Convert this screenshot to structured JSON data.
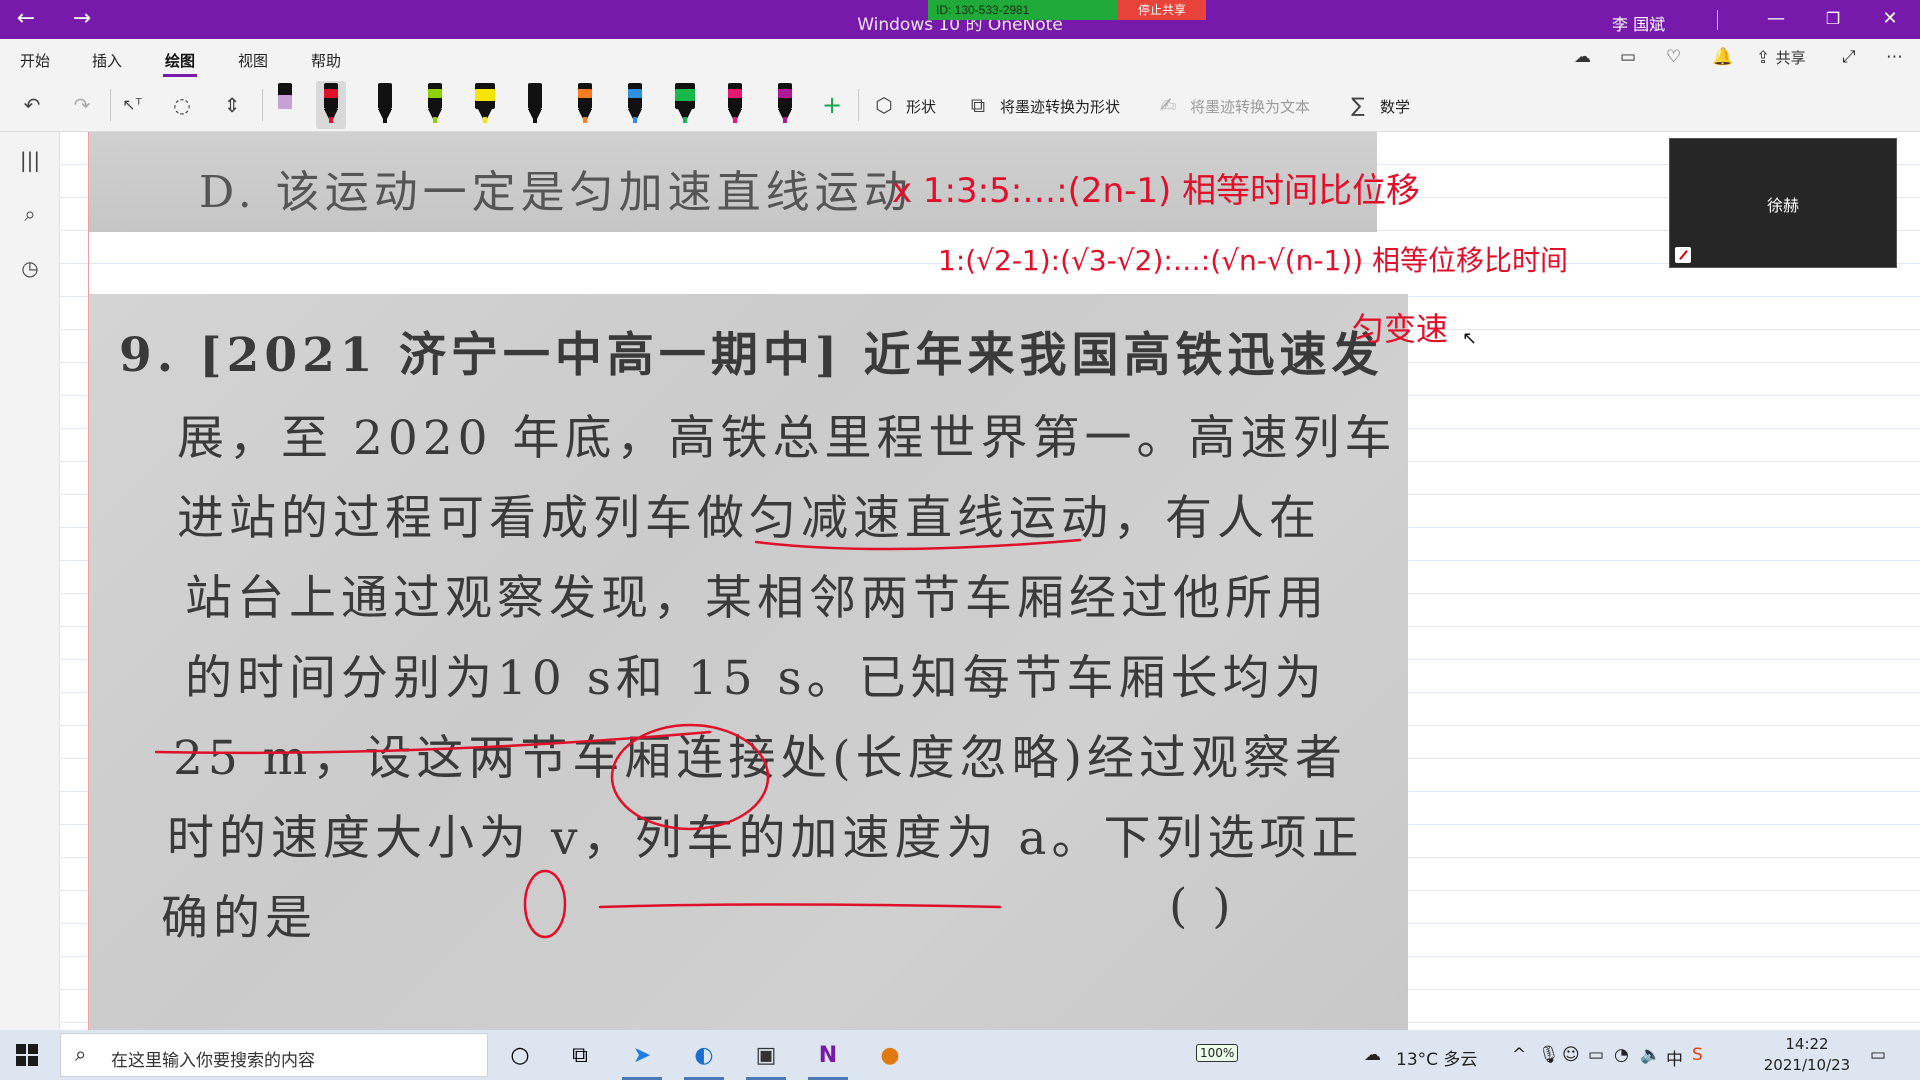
{
  "titlebar": {
    "title": "Windows 10 的 OneNote",
    "back_icon": "back-arrow-icon",
    "forward_icon": "forward-arrow-icon",
    "share_id": "ID: 130-533-2981",
    "stop_share": "停止共享",
    "user": "李 国斌",
    "minimize": "—",
    "restore": "❐",
    "close": "✕"
  },
  "menu": {
    "tabs": [
      "开始",
      "插入",
      "绘图",
      "视图",
      "帮助"
    ],
    "active_tab": "绘图",
    "share_label": "共享"
  },
  "toolbar": {
    "shapes_label": "形状",
    "ink_to_shape_label": "将墨迹转换为形状",
    "ink_to_text_label": "将墨迹转换为文本",
    "math_label": "数学",
    "pens": [
      {
        "color": "#c8a0d8",
        "kind": "eraser"
      },
      {
        "color": "#e0102a",
        "kind": "pen"
      },
      {
        "color": "#111111",
        "kind": "pen"
      },
      {
        "color": "#8fd000",
        "kind": "pen"
      },
      {
        "color": "#f4e400",
        "kind": "highlighter"
      },
      {
        "color": "#111111",
        "kind": "pattern"
      },
      {
        "color": "#ff7a20",
        "kind": "pen"
      },
      {
        "color": "#2d8fe0",
        "kind": "pen"
      },
      {
        "color": "#19b84a",
        "kind": "highlighter"
      },
      {
        "color": "#e81870",
        "kind": "pattern"
      },
      {
        "color": "#b0189a",
        "kind": "pen"
      }
    ]
  },
  "page": {
    "top_photo_line": "D. 该运动一定是匀加速直线运动",
    "problem_lines": [
      "9. [2021 济宁一中高一期中] 近年来我国高铁迅速发",
      "展，至 2020 年底，高铁总里程世界第一。高速列车",
      "进站的过程可看成列车做匀减速直线运动，有人在",
      "站台上通过观察发现，某相邻两节车厢经过他所用",
      "的时间分别为10 s和 15 s。已知每节车厢长均为",
      "25 m，设这两节车厢连接处(长度忽略)经过观察者",
      "时的速度大小为 v，列车的加速度为 a。下列选项正",
      "确的是"
    ],
    "answer_paren": "(          )",
    "ink_notes": [
      "x 1:3:5:…:(2n-1)  相等时间比位移",
      "1:(√2-1):(√3-√2):…:(√n-√(n-1))  相等位移比时间",
      "匀变速"
    ]
  },
  "video": {
    "name": "徐赫"
  },
  "taskbar": {
    "search_placeholder": "在这里输入你要搜索的内容",
    "battery": "100%",
    "weather": "13°C 多云",
    "ime": "中",
    "time": "14:22",
    "date": "2021/10/23"
  },
  "colors": {
    "accent": "#7719aa",
    "ink_red": "#e0102a"
  }
}
